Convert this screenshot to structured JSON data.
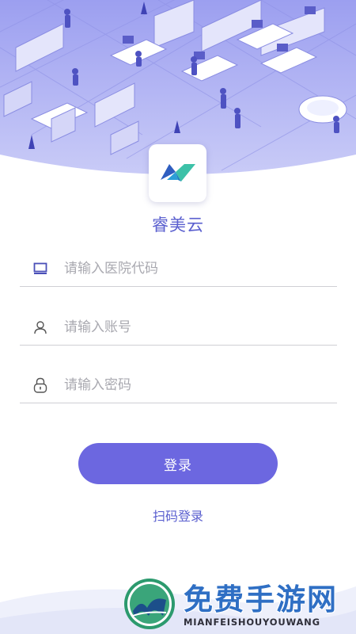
{
  "app": {
    "name": "睿美云"
  },
  "form": {
    "hospital_code_placeholder": "请输入医院代码",
    "account_placeholder": "请输入账号",
    "password_placeholder": "请输入密码",
    "login_label": "登录",
    "scan_login_label": "扫码登录"
  },
  "watermark": {
    "title": "免费手游网",
    "subtitle": "MIANFEISHOUYOUWANG"
  },
  "colors": {
    "accent": "#6c67e0",
    "accent_text": "#5a5fcf",
    "hero_bg": "#a9aaf0",
    "divider": "#cfcfd4"
  },
  "icons": [
    "office-illustration",
    "app-logo-icon",
    "computer-icon",
    "user-icon",
    "lock-icon",
    "watermark-logo-icon"
  ]
}
